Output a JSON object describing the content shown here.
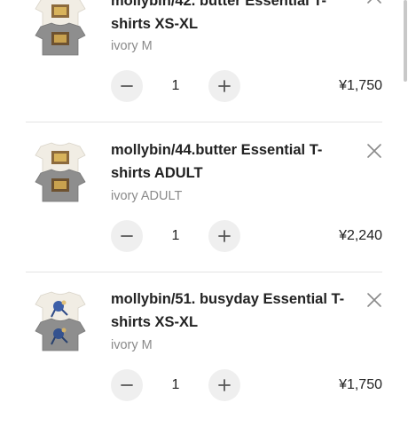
{
  "cart": {
    "items": [
      {
        "title": "mollybin/42. butter Essential T-shirts XS-XL",
        "variant": "ivory M",
        "quantity": "1",
        "price": "¥1,750",
        "thumbnail_icon": "tshirt-butter-icon"
      },
      {
        "title": "mollybin/44.butter Essential T-shirts ADULT",
        "variant": "ivory ADULT",
        "quantity": "1",
        "price": "¥2,240",
        "thumbnail_icon": "tshirt-butter-icon"
      },
      {
        "title": "mollybin/51. busyday Essential T-shirts XS-XL",
        "variant": "ivory M",
        "quantity": "1",
        "price": "¥1,750",
        "thumbnail_icon": "tshirt-busyday-icon"
      }
    ]
  },
  "icons": {
    "remove": "close-icon",
    "decrement": "minus-icon",
    "increment": "plus-icon"
  },
  "colors": {
    "text": "#222222",
    "muted": "#8a8a8a",
    "button_bg": "#efefef",
    "divider": "#e3e3e3",
    "shirt_ivory": "#f1ede4",
    "shirt_gray": "#8e8e8e"
  }
}
